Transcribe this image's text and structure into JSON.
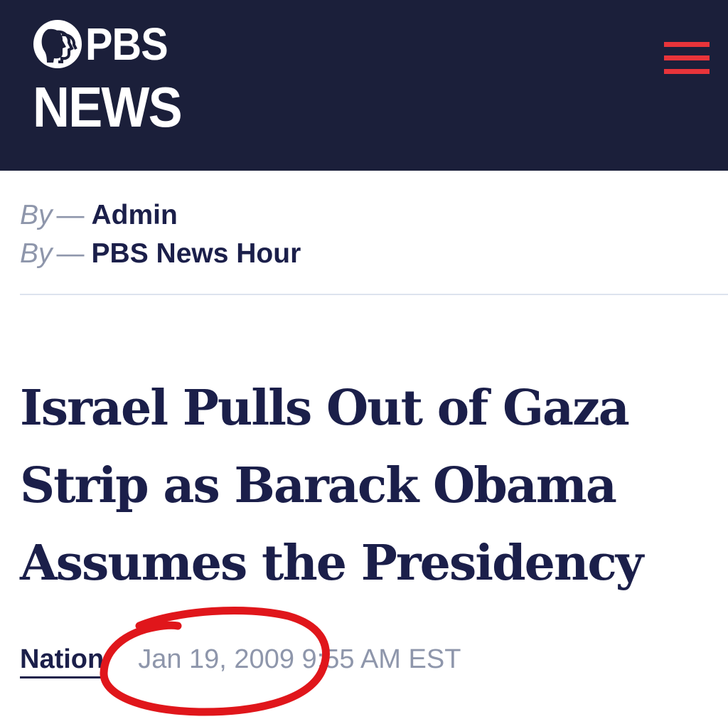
{
  "header": {
    "logo_top": "PBS",
    "logo_bottom": "NEWS",
    "background_color": "#1b1f3a",
    "menu_icon": "hamburger-menu-icon",
    "menu_color": "#e8343a"
  },
  "bylines": [
    {
      "prefix": "By",
      "dash": "—",
      "name": "Admin"
    },
    {
      "prefix": "By",
      "dash": "—",
      "name": "PBS News Hour"
    }
  ],
  "article": {
    "headline": "Israel Pulls Out of Gaza Strip as Barack Obama Assumes the Presidency",
    "category": "Nation",
    "timestamp": "Jan 19, 2009 9:55 AM EST",
    "text_color": "#1b1f4a"
  },
  "annotation": {
    "shape": "hand-drawn-circle",
    "color": "#e0161b"
  }
}
